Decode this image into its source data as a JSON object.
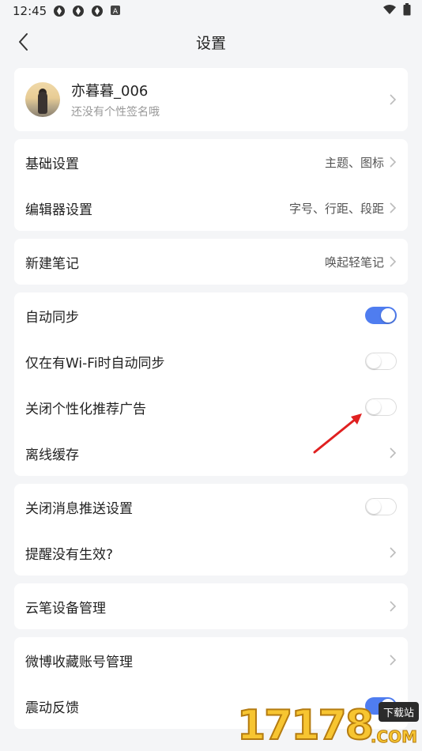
{
  "status_bar": {
    "time": "12:45",
    "notification_badge": "A"
  },
  "header": {
    "title": "设置"
  },
  "profile": {
    "name": "亦暮暮_006",
    "signature": "还没有个性签名哦"
  },
  "sections": {
    "basic": {
      "label": "基础设置",
      "value": "主题、图标"
    },
    "editor": {
      "label": "编辑器设置",
      "value": "字号、行距、段距"
    },
    "new_note": {
      "label": "新建笔记",
      "value": "唤起轻笔记"
    },
    "auto_sync": {
      "label": "自动同步",
      "enabled": true
    },
    "wifi_sync": {
      "label": "仅在有Wi-Fi时自动同步",
      "enabled": false
    },
    "ads": {
      "label": "关闭个性化推荐广告",
      "enabled": false
    },
    "offline": {
      "label": "离线缓存"
    },
    "push": {
      "label": "关闭消息推送设置",
      "enabled": false
    },
    "reminder": {
      "label": "提醒没有生效?"
    },
    "pen": {
      "label": "云笔设备管理"
    },
    "weibo": {
      "label": "微博收藏账号管理"
    },
    "vibrate": {
      "label": "震动反馈",
      "enabled": true
    }
  },
  "watermark": {
    "digits": "17178",
    "badge": "下载站",
    "suffix": ".COM"
  },
  "colors": {
    "accent": "#4f7df0",
    "annotation_arrow": "#e02020",
    "background": "#f4f5f7"
  }
}
